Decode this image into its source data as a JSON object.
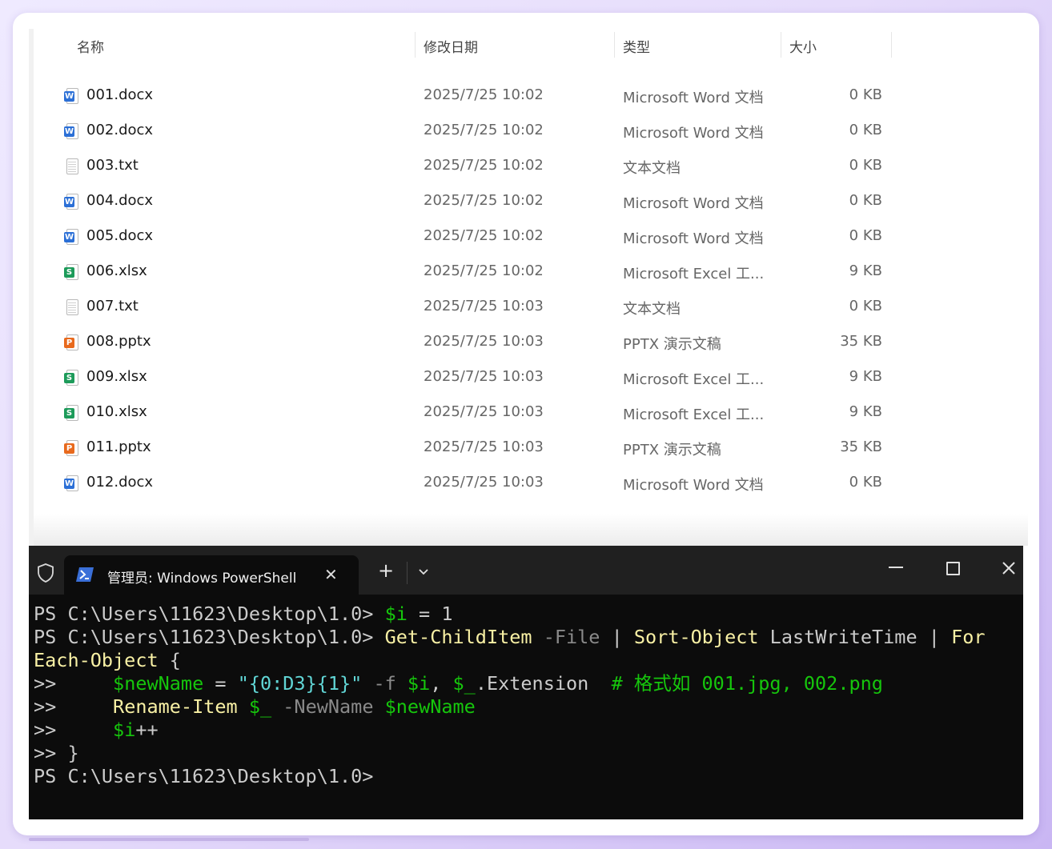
{
  "explorer": {
    "columns": {
      "name": "名称",
      "date": "修改日期",
      "type": "类型",
      "size": "大小"
    },
    "files": [
      {
        "name": "001.docx",
        "date": "2025/7/25 10:02",
        "type": "Microsoft Word 文档",
        "size": "0 KB",
        "icon": "word"
      },
      {
        "name": "002.docx",
        "date": "2025/7/25 10:02",
        "type": "Microsoft Word 文档",
        "size": "0 KB",
        "icon": "word"
      },
      {
        "name": "003.txt",
        "date": "2025/7/25 10:02",
        "type": "文本文档",
        "size": "0 KB",
        "icon": "text"
      },
      {
        "name": "004.docx",
        "date": "2025/7/25 10:02",
        "type": "Microsoft Word 文档",
        "size": "0 KB",
        "icon": "word"
      },
      {
        "name": "005.docx",
        "date": "2025/7/25 10:02",
        "type": "Microsoft Word 文档",
        "size": "0 KB",
        "icon": "word"
      },
      {
        "name": "006.xlsx",
        "date": "2025/7/25 10:02",
        "type": "Microsoft Excel 工...",
        "size": "9 KB",
        "icon": "excel"
      },
      {
        "name": "007.txt",
        "date": "2025/7/25 10:03",
        "type": "文本文档",
        "size": "0 KB",
        "icon": "text"
      },
      {
        "name": "008.pptx",
        "date": "2025/7/25 10:03",
        "type": "PPTX 演示文稿",
        "size": "35 KB",
        "icon": "ppt"
      },
      {
        "name": "009.xlsx",
        "date": "2025/7/25 10:03",
        "type": "Microsoft Excel 工...",
        "size": "9 KB",
        "icon": "excel"
      },
      {
        "name": "010.xlsx",
        "date": "2025/7/25 10:03",
        "type": "Microsoft Excel 工...",
        "size": "9 KB",
        "icon": "excel"
      },
      {
        "name": "011.pptx",
        "date": "2025/7/25 10:03",
        "type": "PPTX 演示文稿",
        "size": "35 KB",
        "icon": "ppt"
      },
      {
        "name": "012.docx",
        "date": "2025/7/25 10:03",
        "type": "Microsoft Word 文档",
        "size": "0 KB",
        "icon": "word"
      }
    ],
    "icon_colors": {
      "word": "#2b6fd6",
      "excel": "#1d9b5a",
      "ppt": "#e86a1e"
    },
    "icon_letters": {
      "word": "W",
      "excel": "S",
      "ppt": "P"
    }
  },
  "terminal": {
    "tab_title": "管理员: Windows PowerShell",
    "new_tab": "+",
    "lines": [
      [
        {
          "t": "PS C:\\Users\\11623\\Desktop\\1.0> ",
          "c": "w"
        },
        {
          "t": "$i",
          "c": "g"
        },
        {
          "t": " = ",
          "c": "w"
        },
        {
          "t": "1",
          "c": "w"
        }
      ],
      [
        {
          "t": "PS C:\\Users\\11623\\Desktop\\1.0> ",
          "c": "w"
        },
        {
          "t": "Get-ChildItem",
          "c": "y"
        },
        {
          "t": " -File",
          "c": "gr"
        },
        {
          "t": " | ",
          "c": "w"
        },
        {
          "t": "Sort-Object",
          "c": "y"
        },
        {
          "t": " LastWriteTime | ",
          "c": "w"
        },
        {
          "t": "For",
          "c": "y"
        }
      ],
      [
        {
          "t": "Each-Object",
          "c": "y"
        },
        {
          "t": " {",
          "c": "w"
        }
      ],
      [
        {
          "t": ">>     ",
          "c": "w"
        },
        {
          "t": "$newName",
          "c": "g"
        },
        {
          "t": " = ",
          "c": "w"
        },
        {
          "t": "\"{0:D3}{1}\"",
          "c": "cy"
        },
        {
          "t": " -f ",
          "c": "gr"
        },
        {
          "t": "$i",
          "c": "g"
        },
        {
          "t": ", ",
          "c": "w"
        },
        {
          "t": "$_",
          "c": "g"
        },
        {
          "t": ".Extension  ",
          "c": "w"
        },
        {
          "t": "# 格式如 001.jpg, 002.png",
          "c": "g"
        }
      ],
      [
        {
          "t": ">>     ",
          "c": "w"
        },
        {
          "t": "Rename-Item",
          "c": "y"
        },
        {
          "t": " ",
          "c": "w"
        },
        {
          "t": "$_",
          "c": "g"
        },
        {
          "t": " -NewName ",
          "c": "gr"
        },
        {
          "t": "$newName",
          "c": "g"
        }
      ],
      [
        {
          "t": ">>     ",
          "c": "w"
        },
        {
          "t": "$i",
          "c": "g"
        },
        {
          "t": "++",
          "c": "w"
        }
      ],
      [
        {
          "t": ">> }",
          "c": "w"
        }
      ],
      [
        {
          "t": "PS C:\\Users\\11623\\Desktop\\1.0>",
          "c": "w"
        }
      ]
    ]
  }
}
